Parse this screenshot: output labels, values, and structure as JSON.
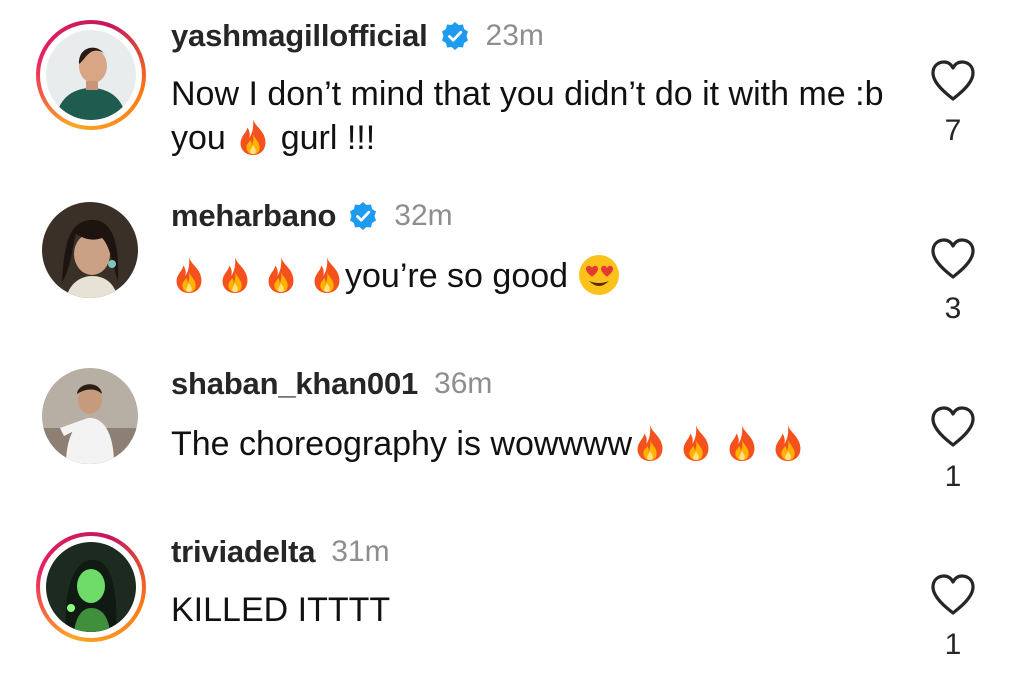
{
  "comments": [
    {
      "username": "yashmagillofficial",
      "verified": true,
      "time": "23m",
      "text_before": "Now I don’t mind that you didn’t do it with me :b you ",
      "text_after": " gurl !!!",
      "likes": "7",
      "avatar_ring": "story"
    },
    {
      "username": "meharbano",
      "verified": true,
      "time": "32m",
      "text_middle": "you’re so good ",
      "likes": "3",
      "avatar_ring": "none"
    },
    {
      "username": "shaban_khan001",
      "verified": false,
      "time": "36m",
      "text": "The choreography is wowwww",
      "likes": "1",
      "avatar_ring": "none"
    },
    {
      "username": "triviadelta",
      "verified": false,
      "time": "31m",
      "text": "KILLED ITTTT",
      "likes": "1",
      "avatar_ring": "story"
    }
  ],
  "icons": {
    "verified": "verified-badge-icon",
    "like": "heart-outline-icon",
    "fire": "fire-emoji",
    "heart_eyes": "heart-eyes-emoji"
  },
  "colors": {
    "verified": "#1d9bf0",
    "muted_text": "#8e8e8e",
    "story_ring_start": "#f9a825",
    "story_ring_end": "#e91e63"
  }
}
